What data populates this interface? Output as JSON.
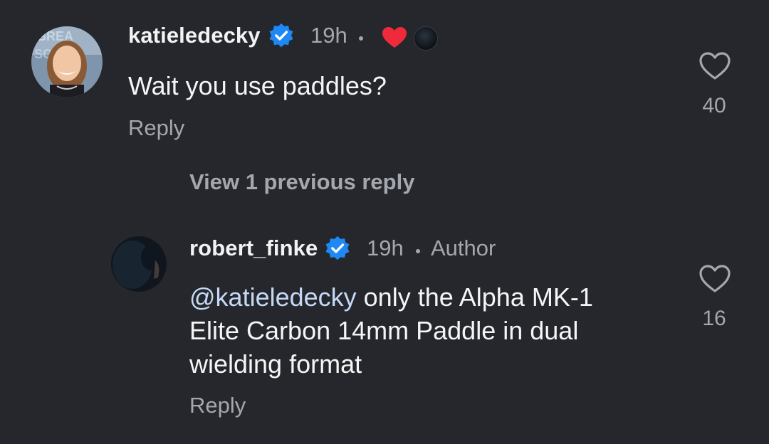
{
  "colors": {
    "background": "#25272d",
    "primary_text": "#f5f5f5",
    "secondary_text": "#a4a7ad",
    "mention": "#c5d9f6",
    "verified_badge": "#1e88f5",
    "heart_red": "#ef2a3a"
  },
  "comments": [
    {
      "username": "katieledecky",
      "verified": true,
      "time": "19h",
      "body": "Wait you use paddles?",
      "reply_label": "Reply",
      "like_count": "40",
      "liked_by_author_icon": "red-heart-icon"
    },
    {
      "username": "robert_finke",
      "verified": true,
      "time": "19h",
      "author_label": "Author",
      "mention": "@katieledecky",
      "body_line1": " only the Alpha MK-1",
      "body_line2": "Elite Carbon 14mm Paddle in dual",
      "body_line3": "wielding format",
      "reply_label": "Reply",
      "like_count": "16"
    }
  ],
  "view_previous_replies": "View 1 previous reply"
}
